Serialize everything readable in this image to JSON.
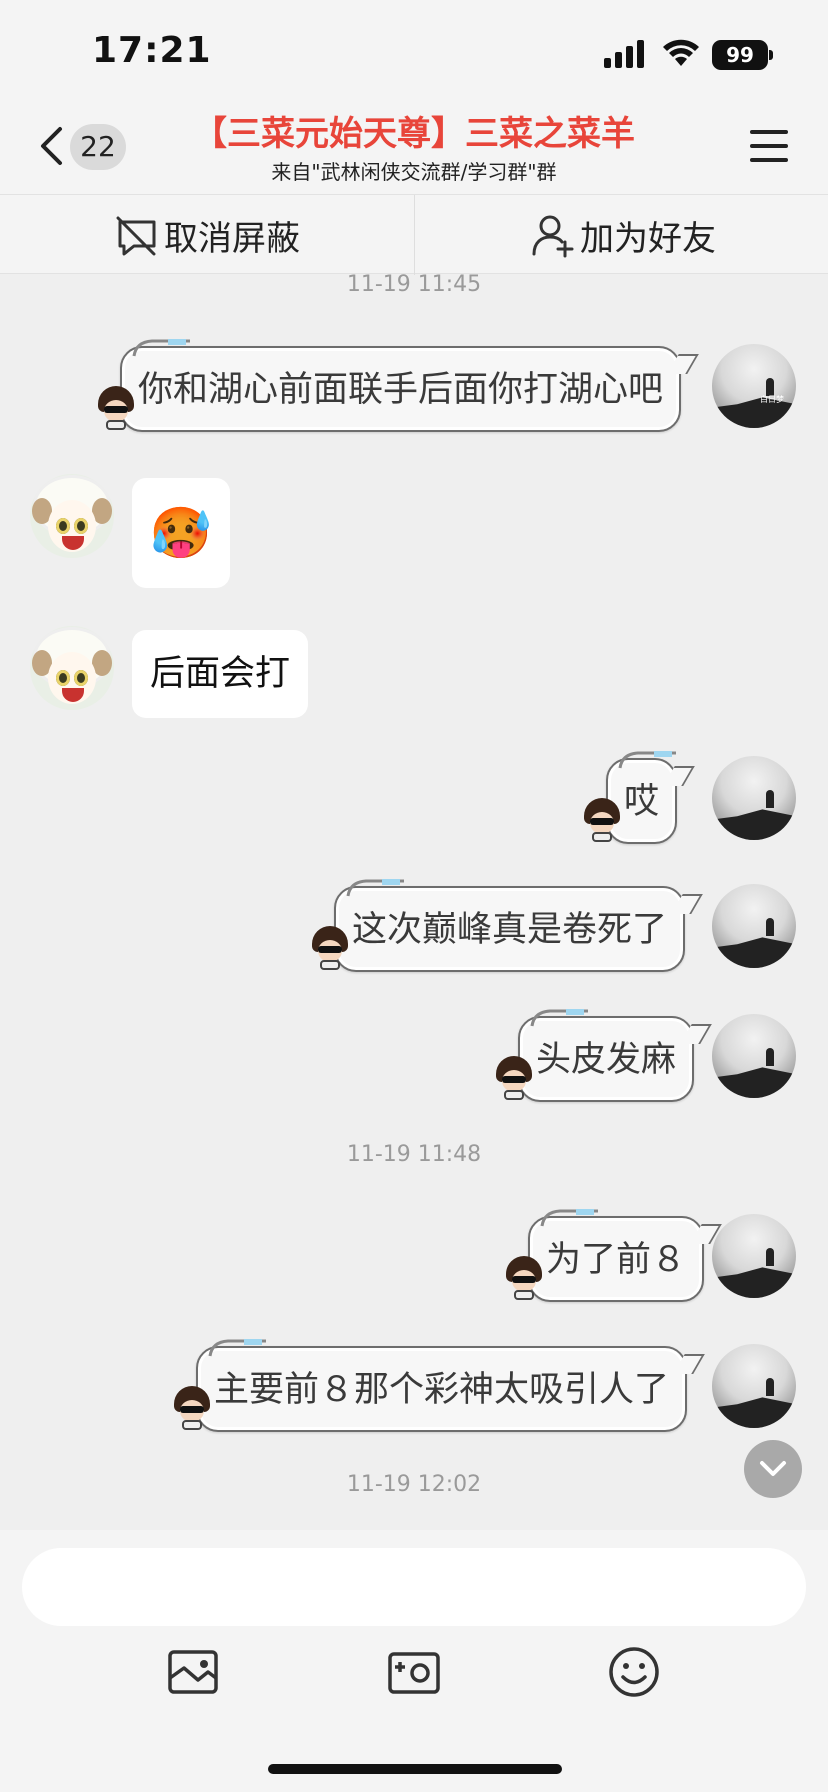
{
  "status_bar": {
    "time": "17:21",
    "battery": "99",
    "icons": [
      "signal-icon",
      "wifi-icon",
      "battery-icon"
    ]
  },
  "header": {
    "back_icon": "chevron-left-icon",
    "unread_count": "22",
    "title": "【三菜元始天尊】三菜之菜羊",
    "subtitle": "来自\"武林闲侠交流群/学习群\"群",
    "menu_icon": "hamburger-menu-icon",
    "title_color": "#e8453a"
  },
  "actions": {
    "unblock_label": "取消屏蔽",
    "unblock_icon": "unblock-icon",
    "add_friend_label": "加为好友",
    "add_friend_icon": "add-user-icon"
  },
  "chat": {
    "timestamps": [
      "11-19 11:45",
      "11-19 11:48",
      "11-19 12:02"
    ],
    "messages": [
      {
        "side": "sent",
        "text": "你和湖心前面联手后面你打湖心吧"
      },
      {
        "side": "received",
        "type": "sticker",
        "emoji": "🥵"
      },
      {
        "side": "received",
        "text": "后面会打"
      },
      {
        "side": "sent",
        "text": "哎"
      },
      {
        "side": "sent",
        "text": "这次巅峰真是卷死了"
      },
      {
        "side": "sent",
        "text": "头皮发麻"
      },
      {
        "side": "sent",
        "text": "为了前８"
      },
      {
        "side": "sent",
        "text": "主要前８那个彩神太吸引人了"
      }
    ],
    "self_avatar_tag": "白日梦"
  },
  "input": {
    "value": "",
    "placeholder": "",
    "toolbar": [
      "photo-icon",
      "camera-icon",
      "emoji-icon"
    ]
  }
}
